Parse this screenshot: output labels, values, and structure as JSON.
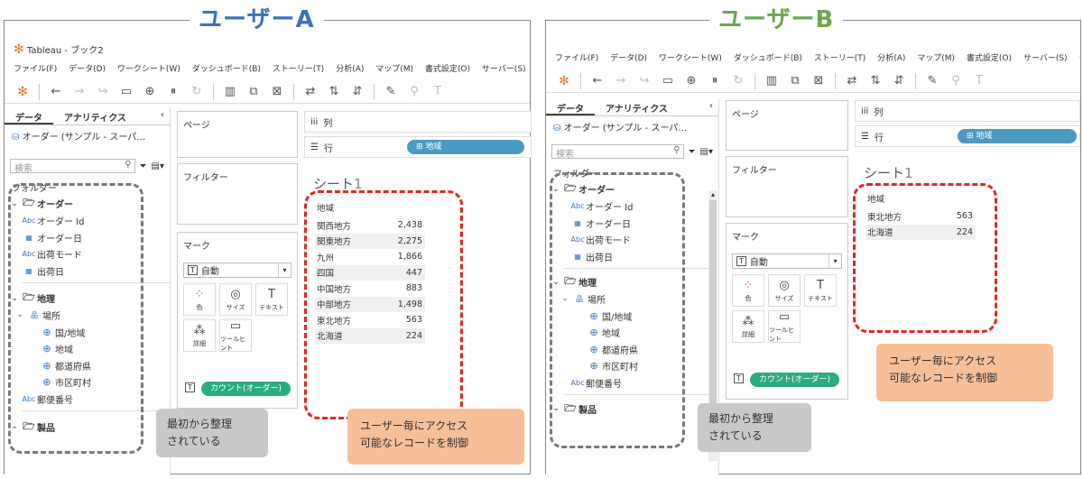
{
  "panels": [
    {
      "user_title": "ユーザーA",
      "window_title": "Tableau - ブック2",
      "menu": [
        "ファイル(F)",
        "データ(D)",
        "ワークシート(W)",
        "ダッシュボード(B)",
        "ストーリー(T)",
        "分析(A)",
        "マップ(M)",
        "書式設定(O)",
        "サーバー(S)",
        "ウィ"
      ],
      "tabs": {
        "data": "データ",
        "analytics": "アナリティクス"
      },
      "datasource": "オーダー (サンプル - スーパ…",
      "search_placeholder": "検索",
      "folder_label": "フォルダー",
      "groups": [
        {
          "name": "オーダー",
          "fields": [
            {
              "type": "Abc",
              "name": "オーダー Id"
            },
            {
              "type": "date",
              "name": "オーダー日"
            },
            {
              "type": "Abc",
              "name": "出荷モード"
            },
            {
              "type": "date",
              "name": "出荷日"
            }
          ]
        },
        {
          "name": "地理",
          "hierarchy": "場所",
          "fields": [
            {
              "type": "globe",
              "name": "国/地域"
            },
            {
              "type": "globe",
              "name": "地域"
            },
            {
              "type": "globe",
              "name": "都道府県"
            },
            {
              "type": "globe",
              "name": "市区町村"
            }
          ],
          "extra": {
            "type": "Abc",
            "name": "郵便番号"
          }
        },
        {
          "name": "製品"
        }
      ],
      "pages_label": "ページ",
      "filters_label": "フィルター",
      "marks_label": "マーク",
      "marks_type": "自動",
      "mark_buttons": [
        "色",
        "サイズ",
        "テキスト",
        "詳細",
        "ツールヒント"
      ],
      "count_pill": "カウント(オーダー)",
      "columns_label": "列",
      "rows_label": "行",
      "rows_pill": "地域",
      "sheet_name": "シート",
      "sheet_num": "1",
      "table_header": "地域",
      "table_rows": [
        {
          "region": "関西地方",
          "count": "2,438"
        },
        {
          "region": "関東地方",
          "count": "2,275"
        },
        {
          "region": "九州",
          "count": "1,866"
        },
        {
          "region": "四国",
          "count": "447"
        },
        {
          "region": "中国地方",
          "count": "883"
        },
        {
          "region": "中部地方",
          "count": "1,498"
        },
        {
          "region": "東北地方",
          "count": "563"
        },
        {
          "region": "北海道",
          "count": "224"
        }
      ],
      "callout_gray": [
        "最初から整理",
        "されている"
      ],
      "callout_orange": [
        "ユーザー毎にアクセス",
        "可能なレコードを制御"
      ]
    },
    {
      "user_title": "ユーザーB",
      "menu": [
        "ファイル(F)",
        "データ(D)",
        "ワークシート(W)",
        "ダッシュボード(B)",
        "ストーリー(T)",
        "分析(A)",
        "マップ(M)",
        "書式設定(O)",
        "サーバー(S)",
        "ウ"
      ],
      "tabs": {
        "data": "データ",
        "analytics": "アナリティクス"
      },
      "datasource": "オーダー (サンプル - スーパ…",
      "search_placeholder": "検索",
      "folder_label": "フォルダー",
      "groups": [
        {
          "name": "オーダー",
          "fields": [
            {
              "type": "Abc",
              "name": "オーダー Id"
            },
            {
              "type": "date",
              "name": "オーダー日"
            },
            {
              "type": "Abc",
              "name": "出荷モード"
            },
            {
              "type": "date",
              "name": "出荷日"
            }
          ]
        },
        {
          "name": "地理",
          "hierarchy": "場所",
          "fields": [
            {
              "type": "globe",
              "name": "国/地域"
            },
            {
              "type": "globe",
              "name": "地域"
            },
            {
              "type": "globe",
              "name": "都道府県"
            },
            {
              "type": "globe",
              "name": "市区町村"
            }
          ],
          "extra": {
            "type": "Abc",
            "name": "郵便番号"
          }
        },
        {
          "name": "製品"
        }
      ],
      "pages_label": "ページ",
      "filters_label": "フィルター",
      "marks_label": "マーク",
      "marks_type": "自動",
      "mark_buttons": [
        "色",
        "サイズ",
        "テキスト",
        "詳細",
        "ツールヒント"
      ],
      "count_pill": "カウント(オーダー)",
      "columns_label": "列",
      "rows_label": "行",
      "rows_pill": "地域",
      "sheet_name": "シート",
      "sheet_num": "1",
      "table_header": "地域",
      "table_rows": [
        {
          "region": "東北地方",
          "count": "563"
        },
        {
          "region": "北海道",
          "count": "224"
        }
      ],
      "callout_gray": [
        "最初から整理",
        "されている"
      ],
      "callout_orange": [
        "ユーザー毎にアクセス",
        "可能なレコードを制御"
      ]
    }
  ],
  "icons": {
    "logo": "tableau-logo-icon",
    "back": "back-arrow-icon",
    "forward": "forward-arrow-icon",
    "save": "save-icon",
    "new-datasource": "new-datasource-icon",
    "filter": "filter-icon",
    "search": "search-icon",
    "globe": "globe-icon",
    "calendar": "calendar-icon"
  },
  "colors": {
    "title_a": "#3b73b9",
    "title_b": "#6aa84f",
    "pill_green": "#2bac80",
    "pill_blue": "#4a9ac4",
    "dashed_red": "#e0281c",
    "callout_orange": "#f7bf98",
    "callout_gray": "#c9c9c9"
  }
}
